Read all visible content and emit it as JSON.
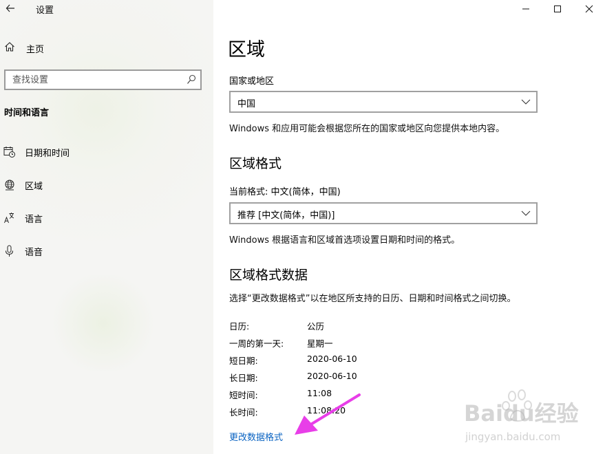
{
  "window": {
    "title": "设置",
    "controls": [
      "minimize-icon",
      "maximize-icon",
      "close-icon"
    ]
  },
  "sidebar": {
    "home_label": "主页",
    "search": {
      "placeholder": "查找设置",
      "value": ""
    },
    "section_title": "时间和语言",
    "items": [
      {
        "label": "日期和时间",
        "icon": "calendar-clock-icon"
      },
      {
        "label": "区域",
        "icon": "globe-icon"
      },
      {
        "label": "语言",
        "icon": "language-icon"
      },
      {
        "label": "语音",
        "icon": "microphone-icon"
      }
    ]
  },
  "main": {
    "title": "区域",
    "country": {
      "label": "国家或地区",
      "value": "中国",
      "description": "Windows 和应用可能会根据您所在的国家或地区向您提供本地内容。"
    },
    "regional_format": {
      "heading": "区域格式",
      "current_label": "当前格式: 中文(简体，中国)",
      "value": "推荐 [中文(简体，中国)]",
      "description": "Windows 根据语言和区域首选项设置日期和时间的格式。"
    },
    "format_data": {
      "heading": "区域格式数据",
      "description": "选择“更改数据格式”以在地区所支持的日历、日期和时间格式之间切换。",
      "rows": [
        {
          "key": "日历:",
          "value": "公历"
        },
        {
          "key": "一周的第一天:",
          "value": "星期一"
        },
        {
          "key": "短日期:",
          "value": "2020-06-10"
        },
        {
          "key": "长日期:",
          "value": "2020-06-10"
        },
        {
          "key": "短时间:",
          "value": "11:08"
        },
        {
          "key": "长时间:",
          "value": "11:08:20"
        }
      ],
      "change_link": "更改数据格式"
    }
  },
  "annotation": {
    "arrow_color": "#e83ee8"
  },
  "watermark": {
    "brand": "Baidu经验",
    "url": "jingyan.baidu.com"
  },
  "colors": {
    "link": "#0a63c2",
    "sidebar_bg": "#f4f5f1"
  }
}
